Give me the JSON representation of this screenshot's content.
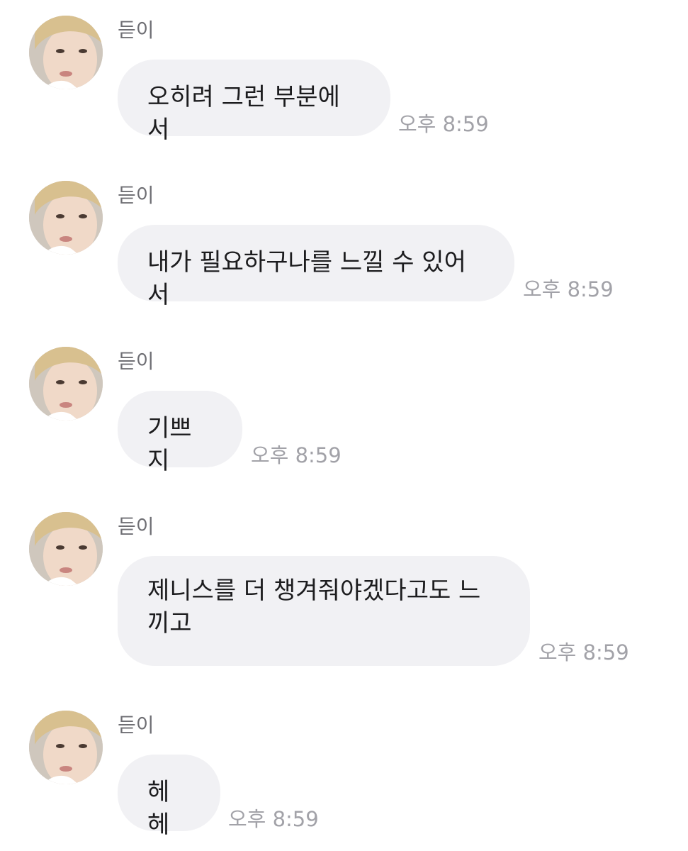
{
  "messages": [
    {
      "sender": "듣이",
      "text": "오히려 그런 부분에서",
      "time": "오후 8:59"
    },
    {
      "sender": "듣이",
      "text": "내가 필요하구나를 느낄 수 있어서",
      "time": "오후 8:59"
    },
    {
      "sender": "듣이",
      "text": "기쁘지",
      "time": "오후 8:59"
    },
    {
      "sender": "듣이",
      "text": "제니스를 더 챙겨줘야겠다고도 느끼고",
      "time": "오후 8:59"
    },
    {
      "sender": "듣이",
      "text": "헤헤",
      "time": "오후 8:59"
    }
  ],
  "avatar_icon": "profile-photo",
  "colors": {
    "bubble": "#f1f1f4",
    "sender_name": "#6f6f74",
    "timestamp": "#a2a2a8",
    "message_text": "#1c1c1e"
  }
}
